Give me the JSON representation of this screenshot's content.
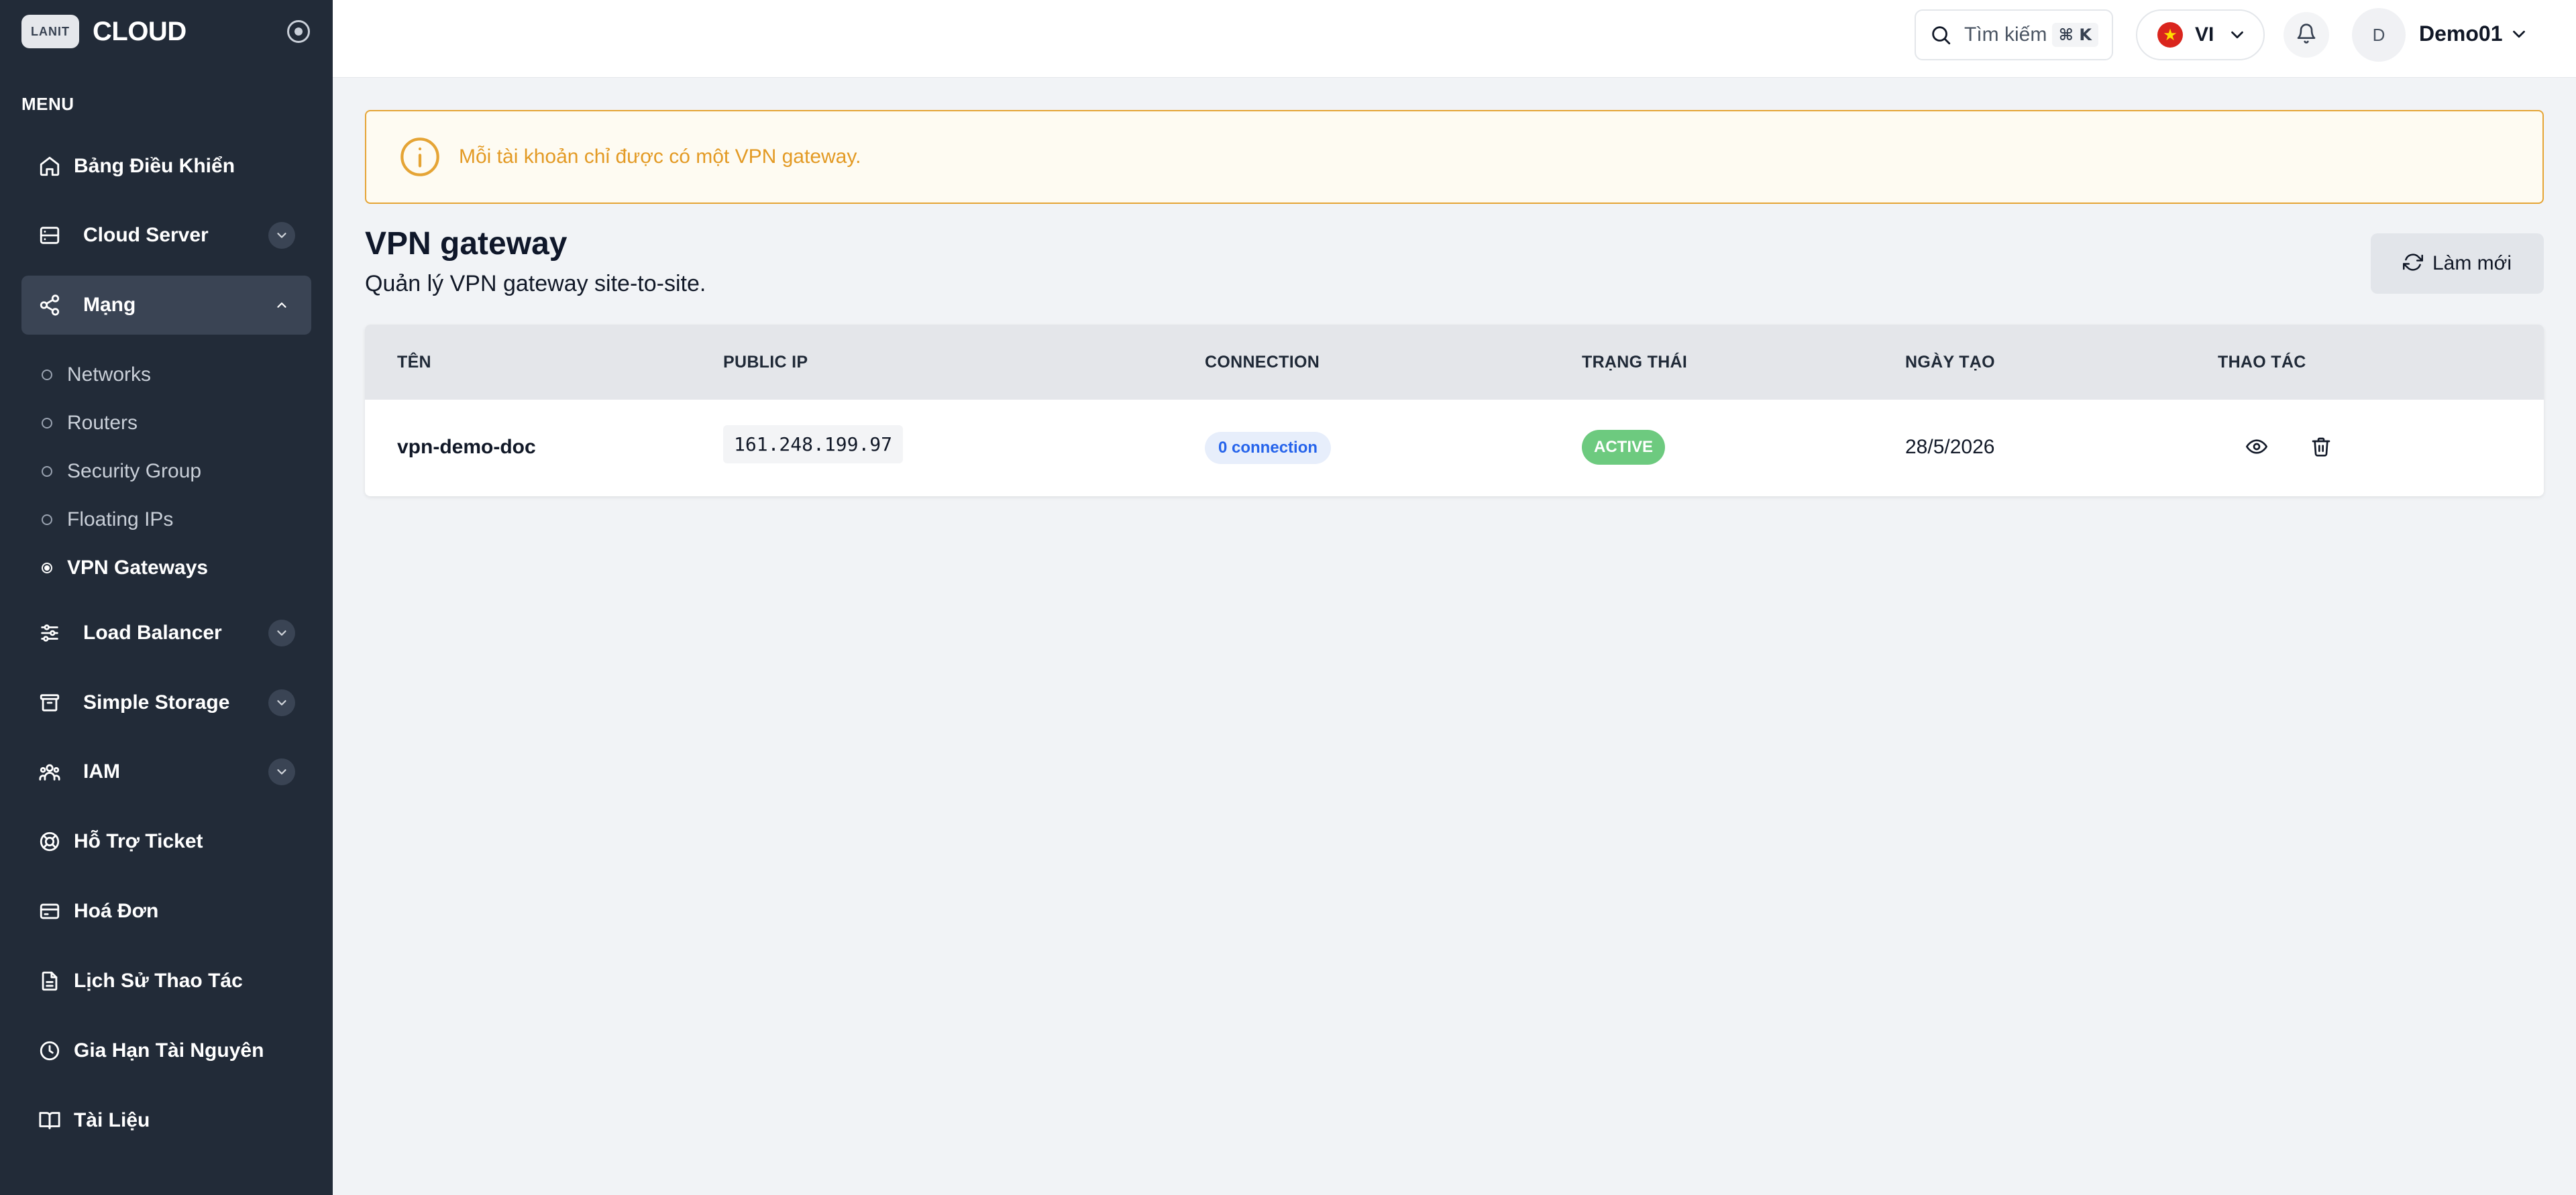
{
  "brand": {
    "logo_text": "LANIT",
    "name": "CLOUD"
  },
  "sidebar": {
    "menu_title": "MENU",
    "items": [
      {
        "label": "Bảng Điều Khiển",
        "icon": "home-icon"
      },
      {
        "label": "Cloud Server",
        "icon": "server-icon",
        "expandable": true
      },
      {
        "label": "Mạng",
        "icon": "share-icon",
        "expandable": true,
        "expanded": true,
        "children": [
          {
            "label": "Networks"
          },
          {
            "label": "Routers"
          },
          {
            "label": "Security Group"
          },
          {
            "label": "Floating IPs"
          },
          {
            "label": "VPN Gateways",
            "active": true
          }
        ]
      },
      {
        "label": "Load Balancer",
        "icon": "sliders-icon",
        "expandable": true
      },
      {
        "label": "Simple Storage",
        "icon": "archive-icon",
        "expandable": true
      },
      {
        "label": "IAM",
        "icon": "users-icon",
        "expandable": true
      },
      {
        "label": "Hỗ Trợ Ticket",
        "icon": "lifebuoy-icon"
      },
      {
        "label": "Hoá Đơn",
        "icon": "credit-card-icon"
      },
      {
        "label": "Lịch Sử Thao Tác",
        "icon": "file-icon"
      },
      {
        "label": "Gia Hạn Tài Nguyên",
        "icon": "clock-icon"
      },
      {
        "label": "Tài Liệu",
        "icon": "book-icon"
      }
    ]
  },
  "header": {
    "search_label": "Tìm kiếm",
    "search_shortcut": "⌘ K",
    "language": "VI",
    "user_initial": "D",
    "username": "Demo01"
  },
  "alert": {
    "text": "Mỗi tài khoản chỉ được có một VPN gateway."
  },
  "page": {
    "title": "VPN gateway",
    "subtitle": "Quản lý VPN gateway site-to-site.",
    "refresh_label": "Làm mới"
  },
  "table": {
    "columns": [
      "TÊN",
      "PUBLIC IP",
      "CONNECTION",
      "TRẠNG THÁI",
      "NGÀY TẠO",
      "THAO TÁC"
    ],
    "rows": [
      {
        "name": "vpn-demo-doc",
        "public_ip": "161.248.199.97",
        "connection": "0 connection",
        "status": "ACTIVE",
        "created": "28/5/2026"
      }
    ]
  },
  "colors": {
    "sidebar_bg": "#222b38",
    "alert_border": "#e5a435",
    "status_active": "#6dca7f",
    "connection_badge": "#2563eb"
  }
}
